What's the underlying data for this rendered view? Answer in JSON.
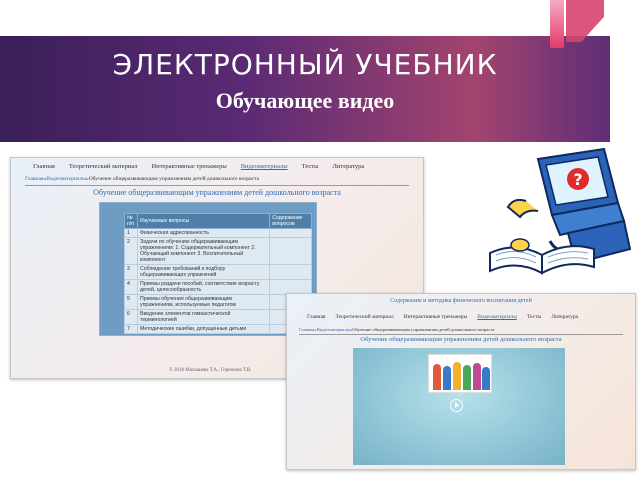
{
  "slide": {
    "title": "ЭЛЕКТРОННЫЙ УЧЕБНИК",
    "subtitle": "Обучающее видео"
  },
  "screenshot1": {
    "nav": [
      "Главная",
      "Теоретический материал",
      "Интерактивные тренажеры",
      "Видеоматериалы",
      "Тесты",
      "Литература"
    ],
    "nav_active": "Видеоматериалы",
    "breadcrumb": {
      "home": "Главная",
      "section": "Видеоматериалы",
      "page": "Обучение общеразвивающим упражнениям детей дошкольного возраста"
    },
    "heading": "Обучение общеразвивающим упражнениям детей дошкольного возраста",
    "table": {
      "headers": [
        "№ п/п",
        "Изучаемые вопросы",
        "Содержание вопросов"
      ],
      "rows": [
        {
          "num": "1",
          "text": "Физическая адресованность"
        },
        {
          "num": "2",
          "text": "Задачи по обучению общеразвивающим упражнениям: 1. Содержательный компонент 2. Обучающий компонент 3. Воспитательный компонент"
        },
        {
          "num": "3",
          "text": "Соблюдение требований к подбору общеразвивающих упражнений"
        },
        {
          "num": "4",
          "text": "Приемы раздачи пособий, соответствие возрасту детей, целесообразность"
        },
        {
          "num": "5",
          "text": "Приемы обучения общеразвивающим упражнениям, используемые педагогом"
        },
        {
          "num": "6",
          "text": "Введение элементов гимнастической терминологией"
        },
        {
          "num": "7",
          "text": "Методические ошибки, допущенные детьми"
        }
      ]
    },
    "footer": "© 2018 Малышева Т.А., Горюнова Т.В."
  },
  "screenshot2": {
    "top_title": "Содержание и методика физического воспитания детей",
    "nav": [
      "Главная",
      "Теоретический материал",
      "Интерактивные тренажеры",
      "Видеоматериалы",
      "Тесты",
      "Литература"
    ],
    "nav_active": "Видеоматериалы",
    "breadcrumb": {
      "home": "Главная",
      "section": "Видеоматериалы",
      "page": "Обучение общеразвивающим упражнениям детей дошкольного возраста"
    },
    "heading": "Обучение общеразвивающим упражнениям детей дошкольного возраста",
    "video": {
      "control": "play"
    }
  },
  "colors": {
    "banner": "#4a2466",
    "link": "#2b6fb6",
    "table_header": "#4d7fa8"
  },
  "icons": [
    "computer-reading-book-icon",
    "play-icon"
  ]
}
